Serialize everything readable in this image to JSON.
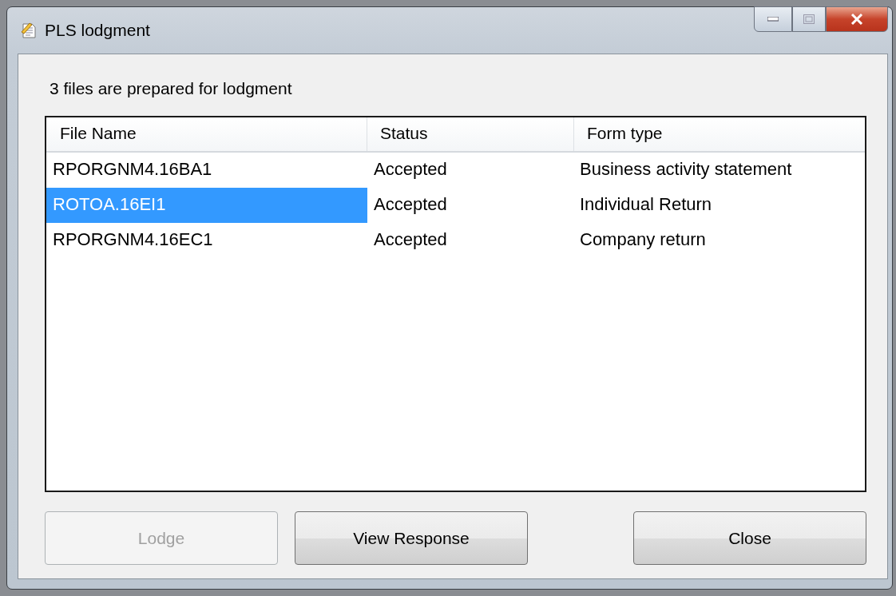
{
  "window": {
    "title": "PLS lodgment"
  },
  "message": "3 files are prepared for lodgment",
  "table": {
    "columns": [
      "File Name",
      "Status",
      "Form type"
    ],
    "rows": [
      {
        "cells": [
          "RPORGNM4.16BA1",
          "Accepted",
          "Business activity statement"
        ],
        "selected": false
      },
      {
        "cells": [
          "ROTOA.16EI1",
          "Accepted",
          "Individual Return"
        ],
        "selected": true
      },
      {
        "cells": [
          "RPORGNM4.16EC1",
          "Accepted",
          "Company return"
        ],
        "selected": false
      }
    ]
  },
  "buttons": [
    {
      "label": "Lodge",
      "disabled": true
    },
    {
      "label": "View Response",
      "disabled": false
    },
    {
      "label": "Close",
      "disabled": false
    }
  ]
}
